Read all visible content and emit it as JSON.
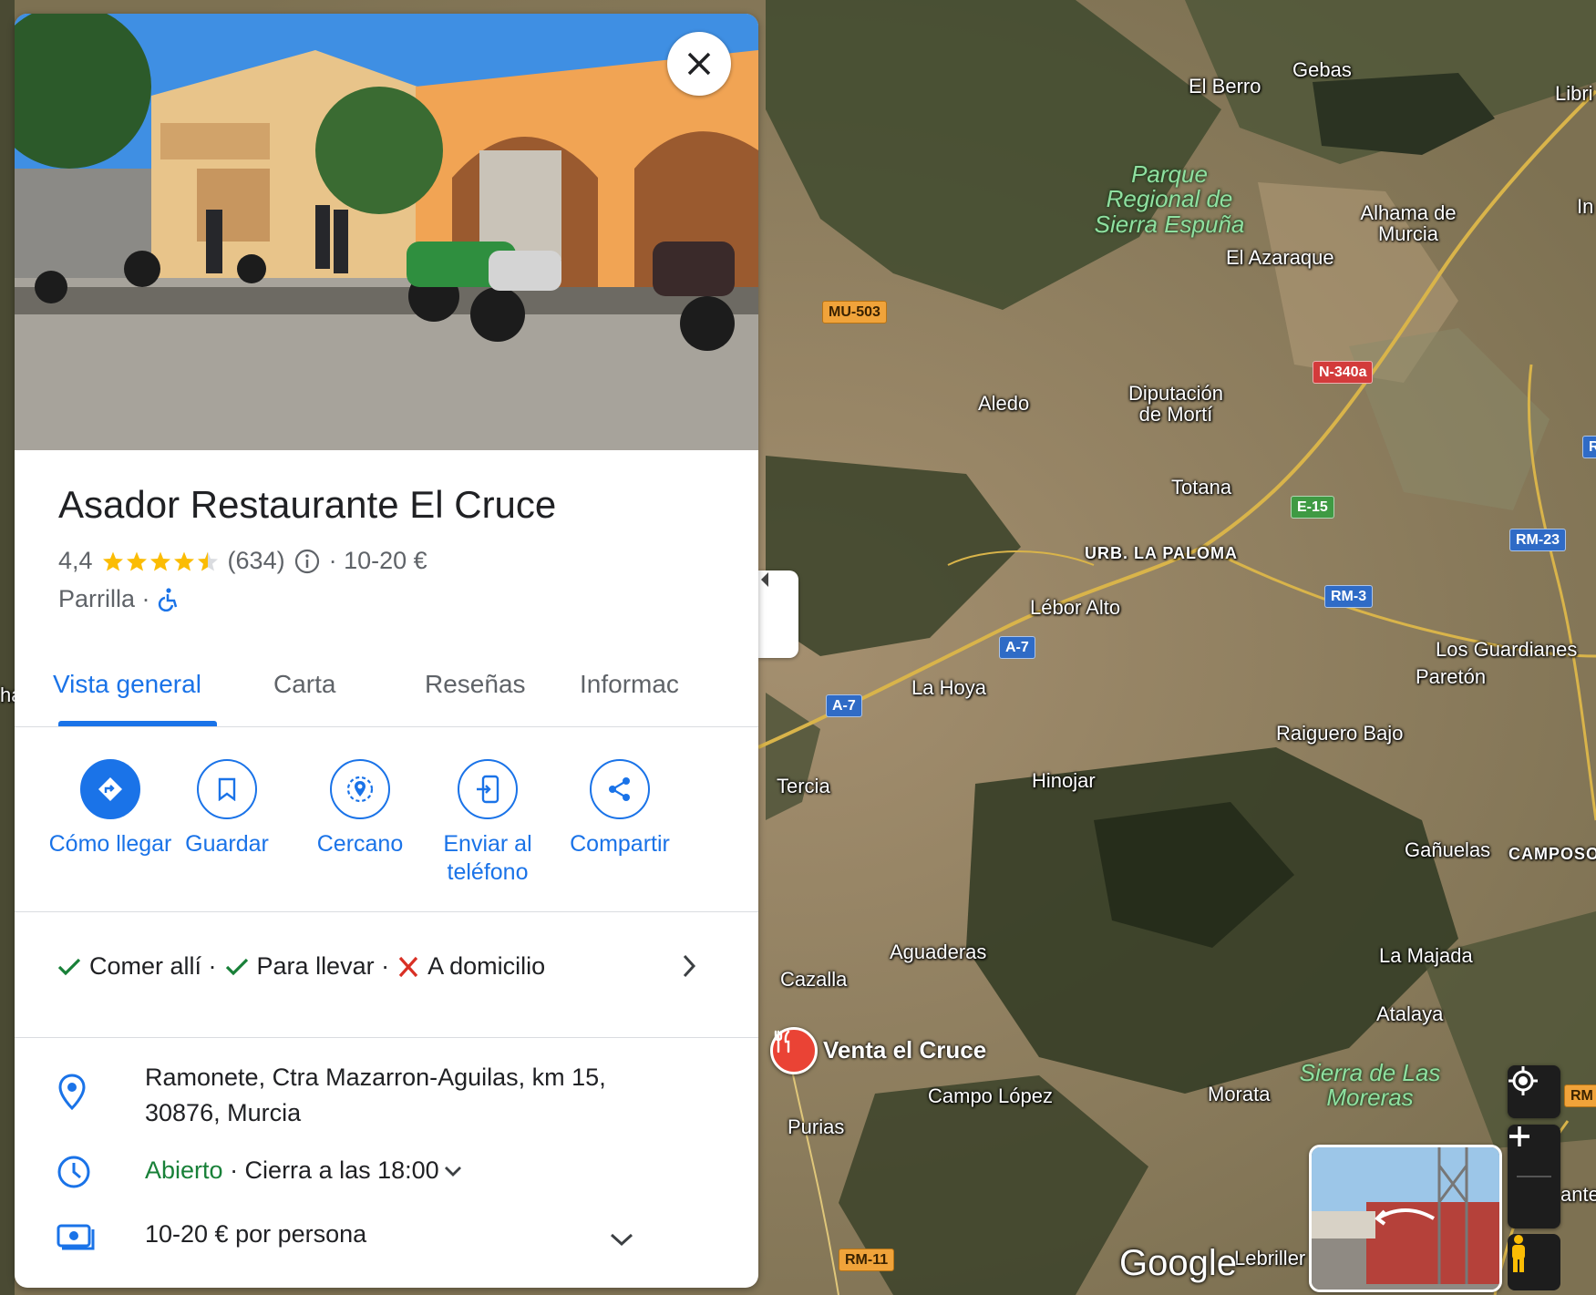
{
  "place": {
    "name": "Asador Restaurante El Cruce",
    "rating": "4,4",
    "stars": 4.4,
    "reviews_count": "(634)",
    "price_sep": "· 10-20 €",
    "category": "Parrilla ·"
  },
  "tabs": [
    {
      "label": "Vista general",
      "active": true
    },
    {
      "label": "Carta",
      "active": false
    },
    {
      "label": "Reseñas",
      "active": false
    },
    {
      "label": "Informac",
      "active": false
    }
  ],
  "actions": [
    {
      "label": "Cómo llegar",
      "icon": "directions-icon"
    },
    {
      "label": "Guardar",
      "icon": "bookmark-icon"
    },
    {
      "label": "Cercano",
      "icon": "nearby-icon"
    },
    {
      "label": "Enviar al teléfono",
      "icon": "send-to-phone-icon"
    },
    {
      "label": "Compartir",
      "icon": "share-icon"
    }
  ],
  "services": {
    "dine_in": "Comer allí ·",
    "takeout": "Para llevar ·",
    "delivery": "A domicilio"
  },
  "info": {
    "address_line1": "Ramonete, Ctra Mazarron-Aguilas, km 15,",
    "address_line2": "30876, Murcia",
    "status_open": "Abierto",
    "closes": " · Cierra a las 18:00",
    "price": "10-20 € por persona"
  },
  "map": {
    "pin_label": "Venta el Cruce",
    "logo": "Google",
    "places": [
      "El Berro",
      "Gebas",
      "Libri",
      "In",
      "Alhama de Murcia",
      "El Azaraque",
      "Aledo",
      "Diputación de Mortí",
      "Totana",
      "URB. LA PALOMA",
      "Lébor Alto",
      "La Hoya",
      "Tercia",
      "Hinojar",
      "Raiguero Bajo",
      "Los Guardianes",
      "Paretón",
      "Gañuelas",
      "CAMPOSO",
      "Aguaderas",
      "Cazalla",
      "La Majada",
      "Atalaya",
      "Campo López",
      "Morata",
      "Purias",
      "Lebriller",
      "ha",
      "ante"
    ],
    "parks": [
      "Parque Regional de Sierra Espuña",
      "Sierra de Las Moreras"
    ],
    "roads": [
      "MU-503",
      "N-340a",
      "E-15",
      "RM-23",
      "RM-3",
      "A-7",
      "A-7",
      "RM-11",
      "R",
      "RM"
    ]
  },
  "colors": {
    "accent": "#1a73e8",
    "open": "#188038",
    "no": "#d93025",
    "star": "#fbbc04",
    "pin": "#ea4335"
  }
}
